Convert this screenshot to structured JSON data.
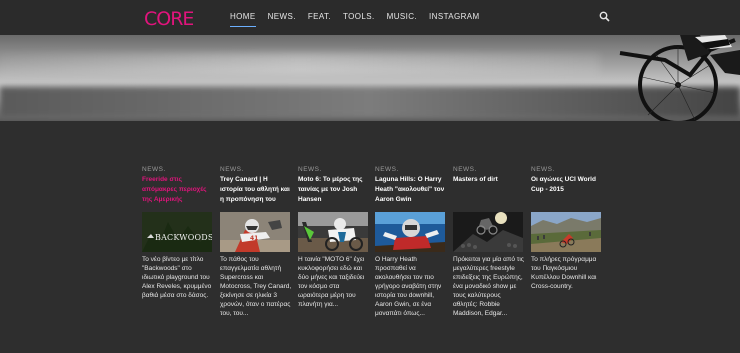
{
  "header": {
    "logo_text": "CORE",
    "logo_color": "#e0147c",
    "nav": [
      {
        "label": "HOME",
        "active": true
      },
      {
        "label": "NEWS."
      },
      {
        "label": "FEAT."
      },
      {
        "label": "TOOLS."
      },
      {
        "label": "MUSIC."
      },
      {
        "label": "INSTAGRAM"
      }
    ],
    "search_icon": "search-icon"
  },
  "cards": [
    {
      "category": "NEWS.",
      "title": "Freeride στις απόμακρες περιοχές της Αμερικής",
      "title_color": "#e0147c",
      "thumb_label": "BACKWOODS",
      "excerpt": "Το νέο βίντεο με τίτλο \"Backwoods\" στο ιδιωτικό playground του Alex Reveles, κρυμμένο βαθιά μέσα στο δάσος."
    },
    {
      "category": "NEWS.",
      "title": "Trey Canard | Η ιστορία του αθλητή και η προπόνηση του",
      "title_color": "#ffffff",
      "excerpt": "Το πάθος του επαγγελματία αθλητή Supercross και Motocross, Trey Canard, ξεκίνησε σε ηλικία 3 χρονών, όταν ο πατέρας του, του..."
    },
    {
      "category": "NEWS.",
      "title": "Moto 6: Το μέρος της ταινίας με τον Josh Hansen",
      "title_color": "#ffffff",
      "excerpt": "Η ταινία \"MOTO 6\" έχει κυκλοφορήσει εδώ και δύο μήνες και ταξιδεύει τον κόσμο στα ωραιότερα μέρη του πλανήτη για..."
    },
    {
      "category": "NEWS.",
      "title": "Laguna Hills: O Harry Heath \"ακολουθεί\" τον Aaron Gwin",
      "title_color": "#ffffff",
      "excerpt": "O Harry Heath προσπαθεί να ακολουθήσει τον πιο γρήγορο αναβάτη στην ιστορία του downhill, Aaron Gwin, σε ένα μοναπάτι όπως..."
    },
    {
      "category": "NEWS.",
      "title": "Masters of dirt",
      "title_color": "#ffffff",
      "excerpt": "Πρόκειται για μία από τις μεγαλύτερες freestyle επιδείξεις της Ευρώπης, ένα μοναδικό show με τους καλύτερους αθλητές: Robbie Maddison, Edgar..."
    },
    {
      "category": "NEWS.",
      "title": "Οι αγώνες UCI World Cup - 2015",
      "title_color": "#ffffff",
      "excerpt": "Το πλήρες πρόγραμμα του Παγκόσμιου Κυπέλλου Downhill και Cross-country."
    }
  ]
}
